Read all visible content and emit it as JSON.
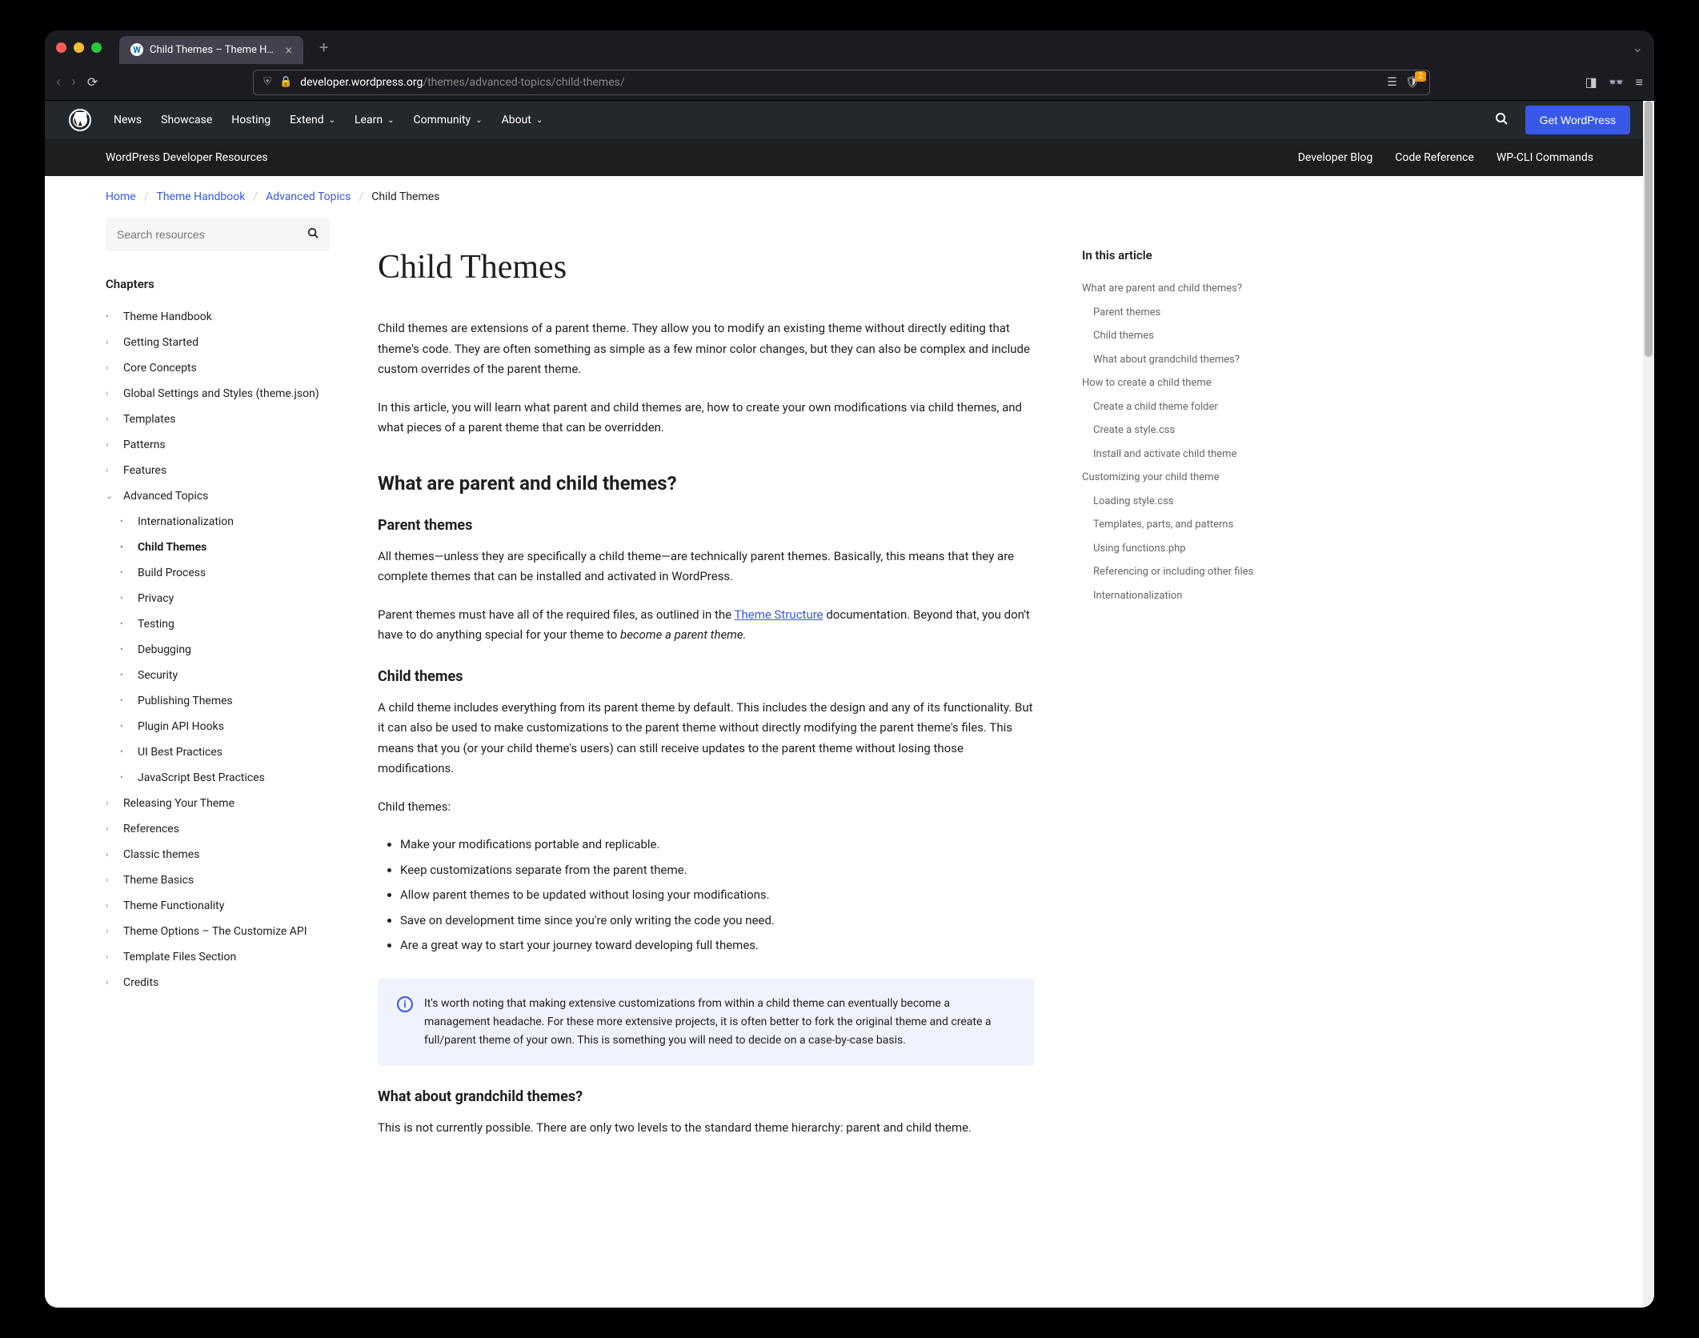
{
  "browser": {
    "tab_title": "Child Themes – Theme Handb",
    "url_prefix": "developer.wordpress.org",
    "url_path": "/themes/advanced-topics/child-themes/",
    "ext_badge": "2"
  },
  "wp_header": {
    "nav": [
      "News",
      "Showcase",
      "Hosting",
      "Extend",
      "Learn",
      "Community",
      "About"
    ],
    "nav_has_chevron": [
      false,
      false,
      false,
      true,
      true,
      true,
      true
    ],
    "get_wp": "Get WordPress"
  },
  "dev_bar": {
    "title": "WordPress Developer Resources",
    "links": [
      "Developer Blog",
      "Code Reference",
      "WP-CLI Commands"
    ]
  },
  "breadcrumb": {
    "items": [
      "Home",
      "Theme Handbook",
      "Advanced Topics"
    ],
    "current": "Child Themes"
  },
  "search": {
    "placeholder": "Search resources"
  },
  "chapters": {
    "heading": "Chapters",
    "items": [
      {
        "label": "Theme Handbook",
        "marker": "•",
        "sub": false
      },
      {
        "label": "Getting Started",
        "marker": "›",
        "sub": false
      },
      {
        "label": "Core Concepts",
        "marker": "›",
        "sub": false
      },
      {
        "label": "Global Settings and Styles (theme.json)",
        "marker": "›",
        "sub": false
      },
      {
        "label": "Templates",
        "marker": "›",
        "sub": false
      },
      {
        "label": "Patterns",
        "marker": "›",
        "sub": false
      },
      {
        "label": "Features",
        "marker": "›",
        "sub": false
      },
      {
        "label": "Advanced Topics",
        "marker": "⌄",
        "sub": false,
        "expanded": true
      },
      {
        "label": "Internationalization",
        "marker": "•",
        "sub": true
      },
      {
        "label": "Child Themes",
        "marker": "•",
        "sub": true,
        "current": true
      },
      {
        "label": "Build Process",
        "marker": "•",
        "sub": true
      },
      {
        "label": "Privacy",
        "marker": "•",
        "sub": true
      },
      {
        "label": "Testing",
        "marker": "•",
        "sub": true
      },
      {
        "label": "Debugging",
        "marker": "•",
        "sub": true
      },
      {
        "label": "Security",
        "marker": "•",
        "sub": true
      },
      {
        "label": "Publishing Themes",
        "marker": "•",
        "sub": true
      },
      {
        "label": "Plugin API Hooks",
        "marker": "•",
        "sub": true
      },
      {
        "label": "UI Best Practices",
        "marker": "•",
        "sub": true
      },
      {
        "label": "JavaScript Best Practices",
        "marker": "•",
        "sub": true
      },
      {
        "label": "Releasing Your Theme",
        "marker": "›",
        "sub": false
      },
      {
        "label": "References",
        "marker": "›",
        "sub": false
      },
      {
        "label": "Classic themes",
        "marker": "›",
        "sub": false
      },
      {
        "label": "Theme Basics",
        "marker": "›",
        "sub": false
      },
      {
        "label": "Theme Functionality",
        "marker": "›",
        "sub": false
      },
      {
        "label": "Theme Options – The Customize API",
        "marker": "›",
        "sub": false
      },
      {
        "label": "Template Files Section",
        "marker": "›",
        "sub": false
      },
      {
        "label": "Credits",
        "marker": "›",
        "sub": false
      }
    ]
  },
  "article": {
    "title": "Child Themes",
    "intro1": "Child themes are extensions of a parent theme. They allow you to modify an existing theme without directly editing that theme's code. They are often something as simple as a few minor color changes, but they can also be complex and include custom overrides of the parent theme.",
    "intro2": "In this article, you will learn what parent and child themes are, how to create your own modifications via child themes, and what pieces of a parent theme that can be overridden.",
    "h2_1": "What are parent and child themes?",
    "h3_parent": "Parent themes",
    "parent1": "All themes—unless they are specifically a child theme—are technically parent themes. Basically, this means that they are complete themes that can be installed and activated in WordPress.",
    "parent2_a": "Parent themes must have all of the required files, as outlined in the ",
    "parent2_link": "Theme Structure",
    "parent2_b": " documentation. Beyond that, you don't have to do anything special for your theme to ",
    "parent2_em": "become a parent theme.",
    "h3_child": "Child themes",
    "child1": "A child theme includes everything from its parent theme by default. This includes the design and any of its functionality. But it can also be used to make customizations to the parent theme without directly modifying the parent theme's files. This means that you (or your child theme's users) can still receive updates to the parent theme without losing those modifications.",
    "child_intro": "Child themes:",
    "child_bullets": [
      "Make your modifications portable and replicable.",
      "Keep customizations separate from the parent theme.",
      "Allow parent themes to be updated without losing your modifications.",
      "Save on development time since you're only writing the code you need.",
      "Are a great way to start your journey toward developing full themes."
    ],
    "info_note": "It's worth noting that making extensive customizations from within a child theme can eventually become a management headache. For these more extensive projects, it is often better to fork the original theme and create a full/parent theme of your own. This is something you will need to decide on a case-by-case basis.",
    "h3_grandchild": "What about grandchild themes?",
    "grandchild1": "This is not currently possible. There are only two levels to the standard theme hierarchy: parent and child theme."
  },
  "toc": {
    "heading": "In this article",
    "items": [
      {
        "label": "What are parent and child themes?",
        "sub": false
      },
      {
        "label": "Parent themes",
        "sub": true
      },
      {
        "label": "Child themes",
        "sub": true
      },
      {
        "label": "What about grandchild themes?",
        "sub": true
      },
      {
        "label": "How to create a child theme",
        "sub": false
      },
      {
        "label": "Create a child theme folder",
        "sub": true
      },
      {
        "label": "Create a style.css",
        "sub": true
      },
      {
        "label": "Install and activate child theme",
        "sub": true
      },
      {
        "label": "Customizing your child theme",
        "sub": false
      },
      {
        "label": "Loading style.css",
        "sub": true
      },
      {
        "label": "Templates, parts, and patterns",
        "sub": true
      },
      {
        "label": "Using functions.php",
        "sub": true
      },
      {
        "label": "Referencing or including other files",
        "sub": true
      },
      {
        "label": "Internationalization",
        "sub": true
      }
    ]
  }
}
